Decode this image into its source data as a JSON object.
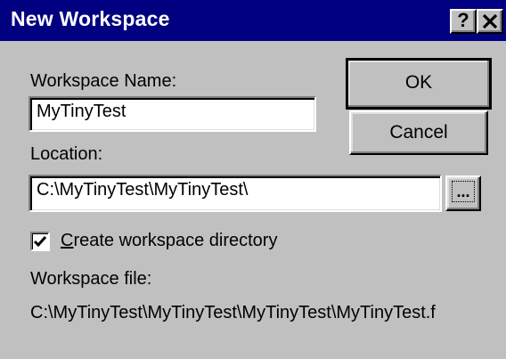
{
  "window": {
    "title": "New Workspace",
    "help_label": "?",
    "close_label": "✕"
  },
  "form": {
    "workspace_name_label": "Workspace Name:",
    "workspace_name_value": "MyTinyTest",
    "location_label": "Location:",
    "location_value": "C:\\MyTinyTest\\MyTinyTest\\",
    "browse_label": "...",
    "create_dir_label": "Create workspace directory",
    "create_dir_checked": true,
    "workspace_file_label": "Workspace file:",
    "workspace_file_value": "C:\\MyTinyTest\\MyTinyTest\\MyTinyTest\\MyTinyTest.f"
  },
  "buttons": {
    "ok_label": "OK",
    "cancel_label": "Cancel"
  },
  "colors": {
    "titlebar": "#000080",
    "face": "#c0c0c0"
  },
  "icons": {
    "help": "question-icon",
    "close": "close-icon",
    "check": "checkmark-icon"
  }
}
